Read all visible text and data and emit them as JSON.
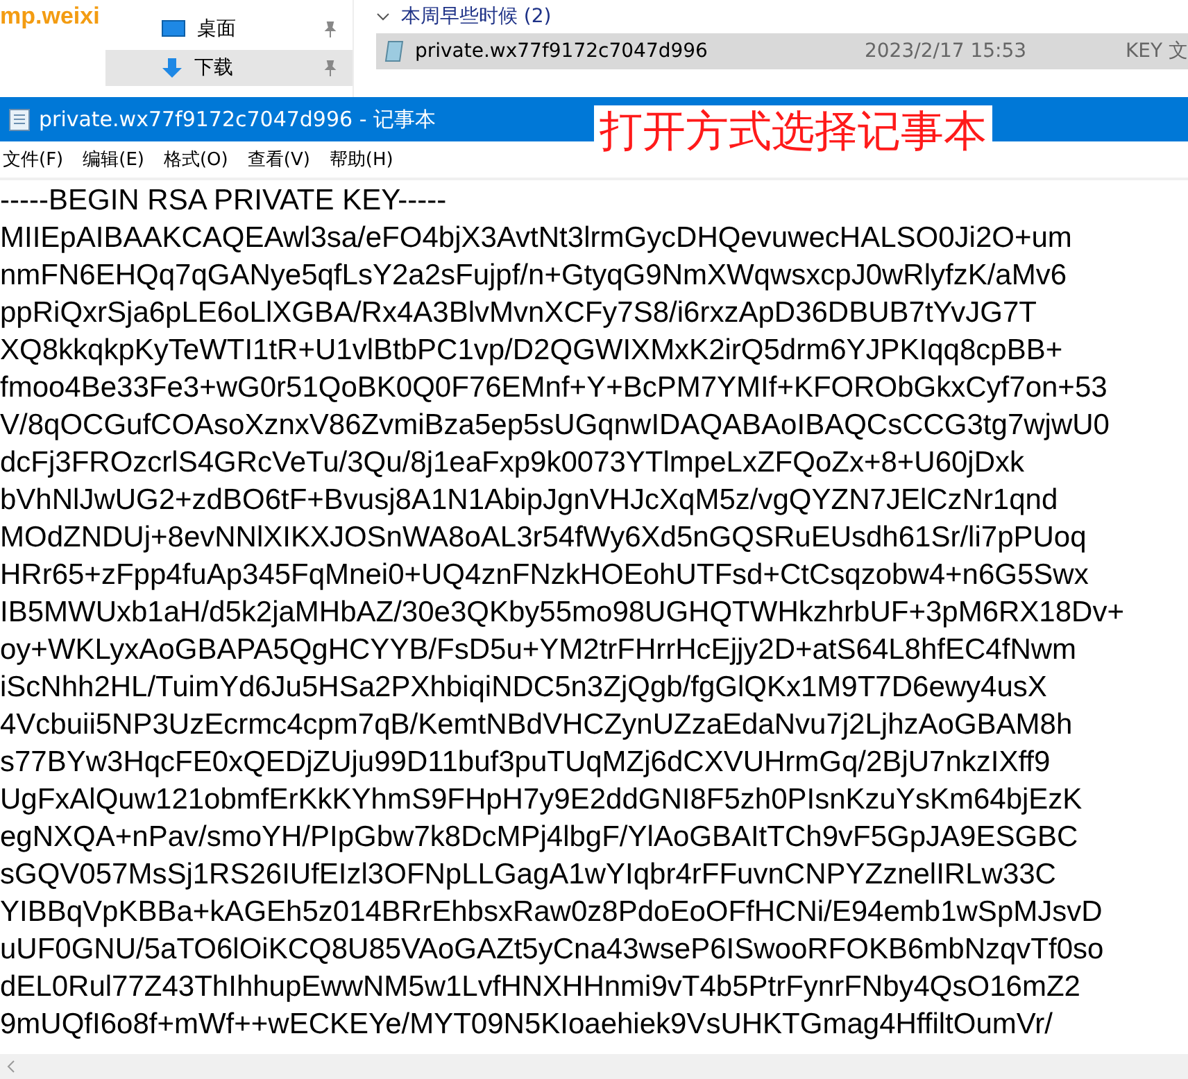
{
  "background_window": {
    "url_fragment": "mp.weixi",
    "sidebar_items": [
      {
        "label": "桌面",
        "kind": "desktop",
        "selected": false
      },
      {
        "label": "下载",
        "kind": "download",
        "selected": true
      }
    ],
    "group_header": "本周早些时候 (2)",
    "files": [
      {
        "name": "private.wx77f9172c7047d996",
        "date": "2023/2/17 15:53",
        "type": "KEY 文",
        "selected": true
      }
    ]
  },
  "window": {
    "title": "private.wx77f9172c7047d996 - 记事本",
    "annotation": "打开方式选择记事本"
  },
  "menu": [
    "文件(F)",
    "编辑(E)",
    "格式(O)",
    "查看(V)",
    "帮助(H)"
  ],
  "lines": [
    "-----BEGIN RSA PRIVATE KEY-----",
    "MIIEpAIBAAKCAQEAwl3sa/eFO4bjX3AvtNt3lrmGycDHQevuwecHALSO0Ji2O+um",
    "nmFN6EHQq7qGANye5qfLsY2a2sFujpf/n+GtyqG9NmXWqwsxcpJ0wRlyfzK/aMv6",
    "ppRiQxrSja6pLE6oLlXGBA/Rx4A3BlvMvnXCFy7S8/i6rxzApD36DBUB7tYvJG7T",
    "XQ8kkqkpKyTeWTI1tR+U1vlBtbPC1vp/D2QGWIXMxK2irQ5drm6YJPKIqq8cpBB+",
    "fmoo4Be33Fe3+wG0r51QoBK0Q0F76EMnf+Y+BcPM7YMIf+KFORObGkxCyf7on+53",
    "V/8qOCGufCOAsoXznxV86ZvmiBza5ep5sUGqnwIDAQABAoIBAQCsCCG3tg7wjwU0",
    "dcFj3FROzcrlS4GRcVeTu/3Qu/8j1eaFxp9k0073YTlmpeLxZFQoZx+8+U60jDxk",
    "bVhNlJwUG2+zdBO6tF+Bvusj8A1N1AbipJgnVHJcXqM5z/vgQYZN7JElCzNr1qnd",
    "MOdZNDUj+8evNNlXIKXJOSnWA8oAL3r54fWy6Xd5nGQSRuEUsdh61Sr/li7pPUoq",
    "HRr65+zFpp4fuAp345FqMnei0+UQ4znFNzkHOEohUTFsd+CtCsqzobw4+n6G5Swx",
    "IB5MWUxb1aH/d5k2jaMHbAZ/30e3QKby55mo98UGHQTWHkzhrbUF+3pM6RX18Dv+",
    "oy+WKLyxAoGBAPA5QgHCYYB/FsD5u+YM2trFHrrHcEjjy2D+atS64L8hfEC4fNwm",
    "iScNhh2HL/TuimYd6Ju5HSa2PXhbiqiNDC5n3ZjQgb/fgGlQKx1M9T7D6ewy4usX",
    "4Vcbuii5NP3UzEcrmc4cpm7qB/KemtNBdVHCZynUZzaEdaNvu7j2LjhzAoGBAM8h",
    "s77BYw3HqcFE0xQEDjZUju99D11buf3puTUqMZj6dCXVUHrmGq/2BjU7nkzIXff9",
    "UgFxAlQuw121obmfErKkKYhmS9FHpH7y9E2ddGNI8F5zh0PIsnKzuYsKm64bjEzK",
    "egNXQA+nPav/smoYH/PIpGbw7k8DcMPj4lbgF/YlAoGBAItTCh9vF5GpJA9ESGBC",
    "sGQV057MsSj1RS26IUfEIzl3OFNpLLGagA1wYIqbr4rFFuvnCNPYZznelIRLw33C",
    "YIBBqVpKBBa+kAGEh5z014BRrEhbsxRaw0z8PdoEoOFfHCNi/E94emb1wSpMJsvD",
    "uUF0GNU/5aTO6lOiKCQ8U85VAoGAZt5yCna43wseP6ISwooRFOKB6mbNzqvTf0so",
    "dEL0Rul77Z43ThIhhupEwwNM5w1LvfHNXHHnmi9vT4b5PtrFynrFNby4QsO16mZ2",
    "9mUQfI6o8f+mWf++wECKEYe/MYT09N5KIoaehiek9VsUHKTGmag4HffiltOumVr/"
  ]
}
